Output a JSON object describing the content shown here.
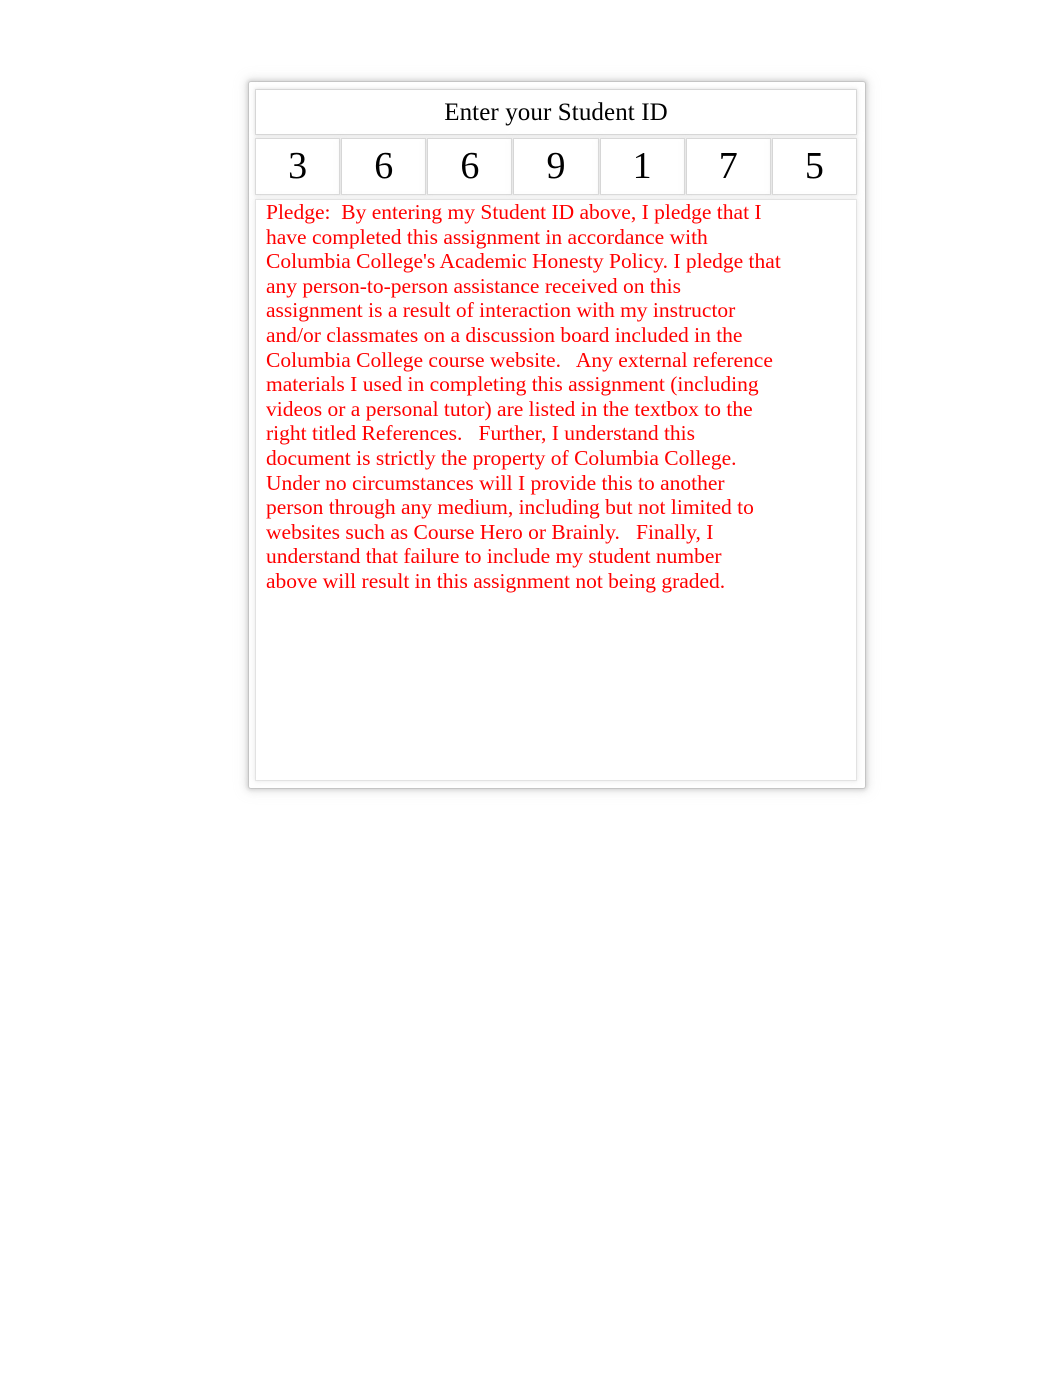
{
  "card": {
    "header_label": "Enter your Student ID",
    "student_id_digits": [
      "3",
      "6",
      "6",
      "9",
      "1",
      "7",
      "5"
    ],
    "pledge_color": "#FF0000",
    "header_text_color": "#000000",
    "pledge_text": "Pledge:  By entering my Student ID above, I pledge that I\nhave completed this assignment in accordance with\nColumbia College's Academic Honesty Policy. I pledge that\nany person-to-person assistance received on this\nassignment is a result of interaction with my instructor\nand/or classmates on a discussion board included in the\nColumbia College course website.   Any external reference\nmaterials I used in completing this assignment (including\nvideos or a personal tutor) are listed in the textbox to the\nright titled References.   Further, I understand this\ndocument is strictly the property of Columbia College.\nUnder no circumstances will I provide this to another\nperson through any medium, including but not limited to\nwebsites such as Course Hero or Brainly.   Finally, I\nunderstand that failure to include my student number\nabove will result in this assignment not being graded."
  }
}
